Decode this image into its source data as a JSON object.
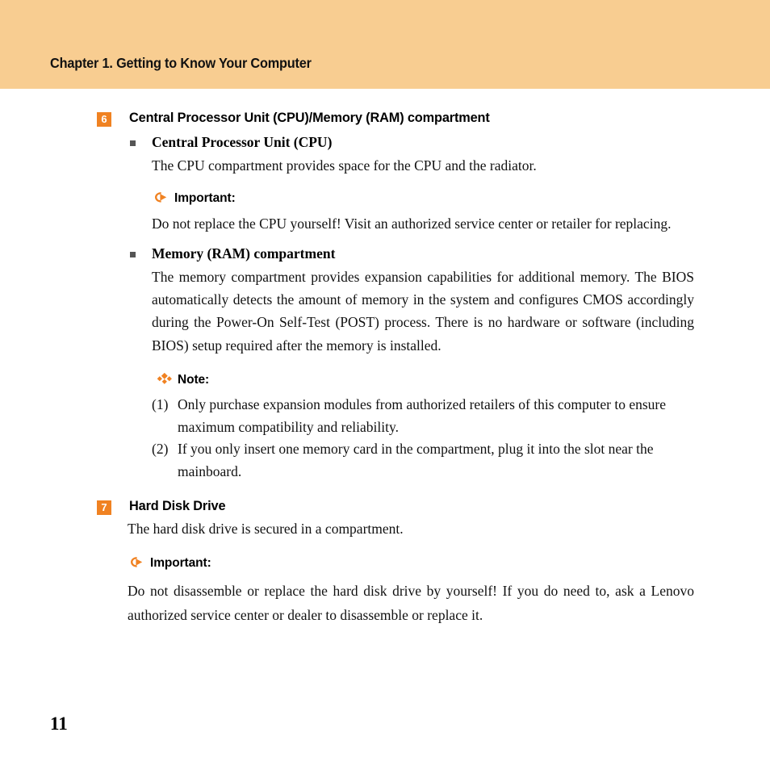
{
  "header": {
    "title": "Chapter 1. Getting to Know Your Computer",
    "band_color": "#f8cd91"
  },
  "theme": {
    "accent_orange": "#f08222",
    "bullet_gray": "#555555",
    "text_color": "#111111"
  },
  "sections": [
    {
      "badge": "6",
      "title": "Central Processor Unit (CPU)/Memory (RAM) compartment",
      "sub_1": {
        "bullet_title": "Central Processor Unit (CPU)",
        "body": "The CPU compartment provides space for the CPU and the radiator.",
        "callout_label": "Important:",
        "callout_icon": "arrow-circle-icon",
        "callout_body": "Do not replace the CPU yourself! Visit an authorized service center or retailer for replacing."
      },
      "sub_2": {
        "bullet_title": "Memory (RAM) compartment",
        "body": "The memory compartment provides expansion capabilities for additional memory. The BIOS automatically detects the amount of memory in the system and configures CMOS accordingly during the Power-On Self-Test (POST) process. There is no hardware or software (including BIOS) setup required after the memory is installed.",
        "note_label": "Note:",
        "note_icon": "diamond-cluster-icon",
        "note_items": [
          {
            "num": "(1)",
            "text": "Only purchase expansion modules from authorized retailers of this computer to ensure maximum compatibility and reliability."
          },
          {
            "num": "(2)",
            "text": "If you only insert one memory card in the compartment, plug it into the slot near the mainboard."
          }
        ]
      }
    },
    {
      "badge": "7",
      "title": "Hard Disk Drive",
      "body": "The hard disk drive is secured in a compartment.",
      "callout_label": "Important:",
      "callout_icon": "arrow-circle-icon",
      "callout_body": "Do not disassemble or replace the hard disk drive by yourself! If you do need to, ask a Lenovo authorized service center or dealer to disassemble or replace it."
    }
  ],
  "footer": {
    "page_number": "11"
  }
}
